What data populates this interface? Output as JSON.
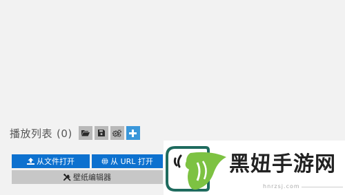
{
  "playlist": {
    "title": "播放列表",
    "count": "(0)",
    "toolbar": [
      {
        "icon": "folder-open-icon"
      },
      {
        "icon": "save-icon"
      },
      {
        "icon": "gears-icon"
      },
      {
        "icon": "plus-icon"
      }
    ]
  },
  "actions": {
    "open_file_label": "从文件打开",
    "open_url_label": "从 URL 打开",
    "wallpaper_editor_label": "壁纸编辑器"
  },
  "watermark": {
    "text": "黑妞手游网",
    "url": "hnrzsj.com"
  },
  "colors": {
    "background": "#f2f2f2",
    "primary_button": "#0d71cf",
    "accent_button": "#3a97da",
    "neutral_button": "#c7c7c7",
    "logo_green": "#7dc242"
  }
}
